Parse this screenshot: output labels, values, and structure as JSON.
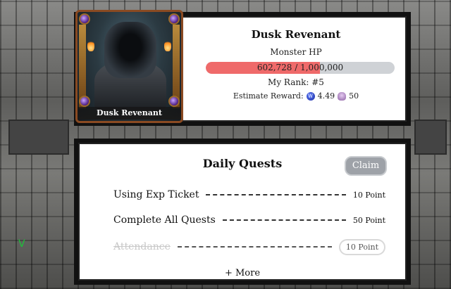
{
  "boss": {
    "name": "Dusk Revenant",
    "portrait_label": "Dusk Revenant",
    "hp_label": "Monster HP",
    "hp_text": "602,728 / 1,000,000",
    "hp_current": 602728,
    "hp_max": 1000000,
    "rank_text": "My Rank: #5",
    "reward_label": "Estimate Reward:",
    "reward_coin_value": "4.49",
    "reward_skull_value": "50"
  },
  "quests": {
    "title": "Daily Quests",
    "claim_label": "Claim",
    "check_mark": "V",
    "items": [
      {
        "name": "Using Exp Ticket",
        "points": "10 Point",
        "done": false
      },
      {
        "name": "Complete All Quests",
        "points": "50 Point",
        "done": false
      },
      {
        "name": "Attendance",
        "points": "10 Point",
        "done": true
      }
    ],
    "more_label": "+ More"
  },
  "colors": {
    "hp_fill": "#ef6a6a",
    "hp_track": "#cfd2d6",
    "claim_bg": "#9ea2a8",
    "check": "#1ec03a"
  }
}
